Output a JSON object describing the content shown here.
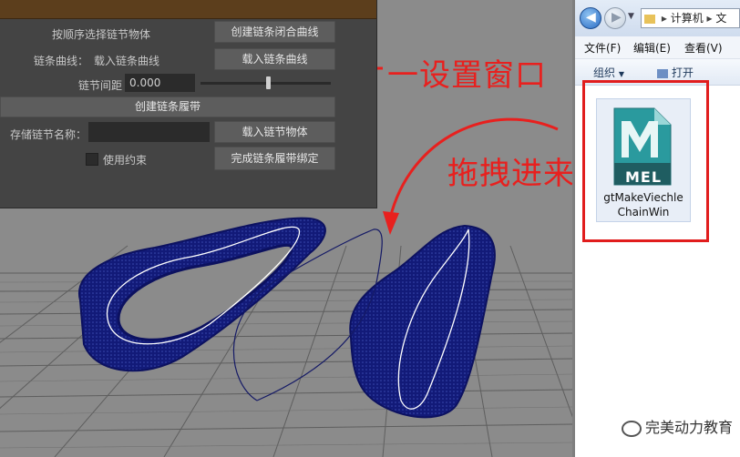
{
  "maya_window": {
    "row1_label": "按顺序选择链节物体",
    "row1_button": "创建链条闭合曲线",
    "row2_label": "链条曲线：",
    "row2_value": "载入链条曲线",
    "row2_button": "载入链条曲线",
    "row3_label": "链节间距",
    "row3_value": "0.000",
    "slider_fraction": 0.52,
    "row4_button": "创建链条履带",
    "row5_label": "存储链节名称：",
    "row5_button": "载入链节物体",
    "row6_checkbox_label": "使用约束",
    "row6_button": "完成链条履带绑定"
  },
  "annotations": {
    "settings_window": "一设置窗口",
    "drag_in": "拖拽进来"
  },
  "explorer": {
    "address": [
      "计算机",
      "文"
    ],
    "menu": [
      "文件(F)",
      "编辑(E)",
      "查看(V)"
    ],
    "toolbar": [
      "组织",
      "打开"
    ],
    "file": {
      "badge": "MEL",
      "name_line1": "gtMakeViechle",
      "name_line2": "ChainWin"
    }
  },
  "watermark": "完美动力教育",
  "colors": {
    "maya_panel": "#444444",
    "maya_button": "#5d5d5d",
    "track_mesh": "#141a6e",
    "annotation_red": "#e8201e",
    "mel_icon_teal": "#2a9a9e"
  }
}
